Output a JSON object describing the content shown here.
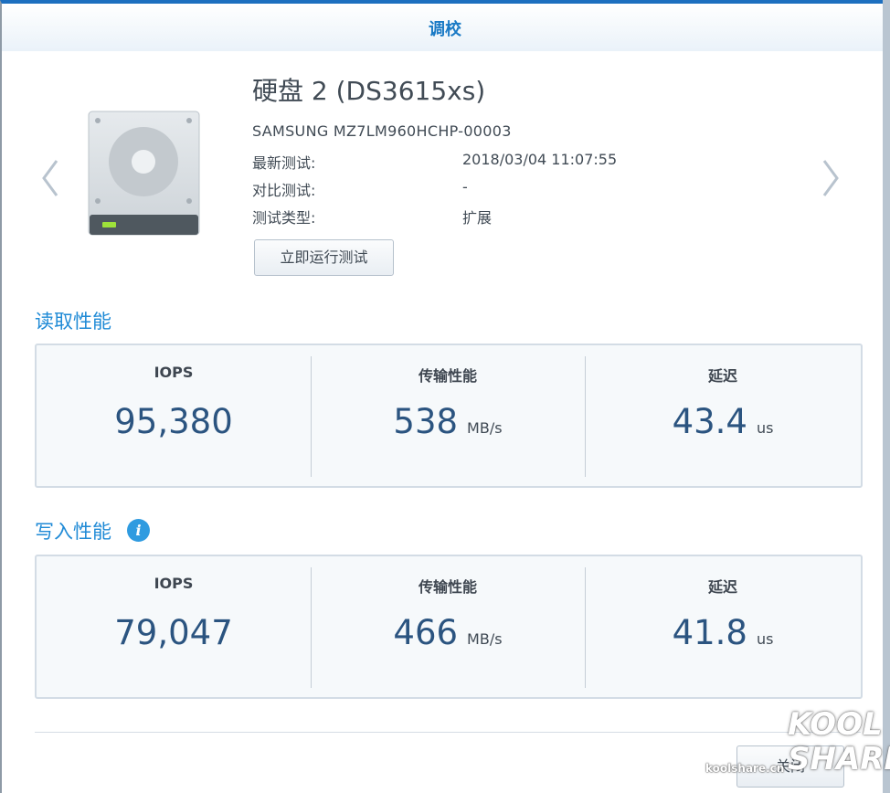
{
  "window": {
    "title": "调校"
  },
  "disk": {
    "name": "硬盘 2 (DS3615xs)",
    "model": "SAMSUNG MZ7LM960HCHP-00003",
    "latest_test_label": "最新测试:",
    "latest_test_value": "2018/03/04 11:07:55",
    "compare_test_label": "对比测试:",
    "compare_test_value": "-",
    "test_type_label": "测试类型:",
    "test_type_value": "扩展",
    "run_button": "立即运行测试"
  },
  "read": {
    "title": "读取性能",
    "iops_label": "IOPS",
    "iops_value": "95,380",
    "throughput_label": "传输性能",
    "throughput_value": "538",
    "throughput_unit": "MB/s",
    "latency_label": "延迟",
    "latency_value": "43.4",
    "latency_unit": "us"
  },
  "write": {
    "title": "写入性能",
    "iops_label": "IOPS",
    "iops_value": "79,047",
    "throughput_label": "传输性能",
    "throughput_value": "466",
    "throughput_unit": "MB/s",
    "latency_label": "延迟",
    "latency_value": "41.8",
    "latency_unit": "us"
  },
  "footer": {
    "close_button": "关闭"
  },
  "watermark": {
    "logo_line1": "KOOL",
    "logo_line2": "SHARE",
    "url": "koolshare.cn"
  },
  "icons": {
    "prev": "chevron-left-icon",
    "next": "chevron-right-icon",
    "disk": "hard-disk-icon",
    "info": "info-icon"
  },
  "colors": {
    "accent": "#1f8ad6",
    "title": "#1a7ac5",
    "value": "#2b5480",
    "panel_bg": "#f6f9fb"
  }
}
